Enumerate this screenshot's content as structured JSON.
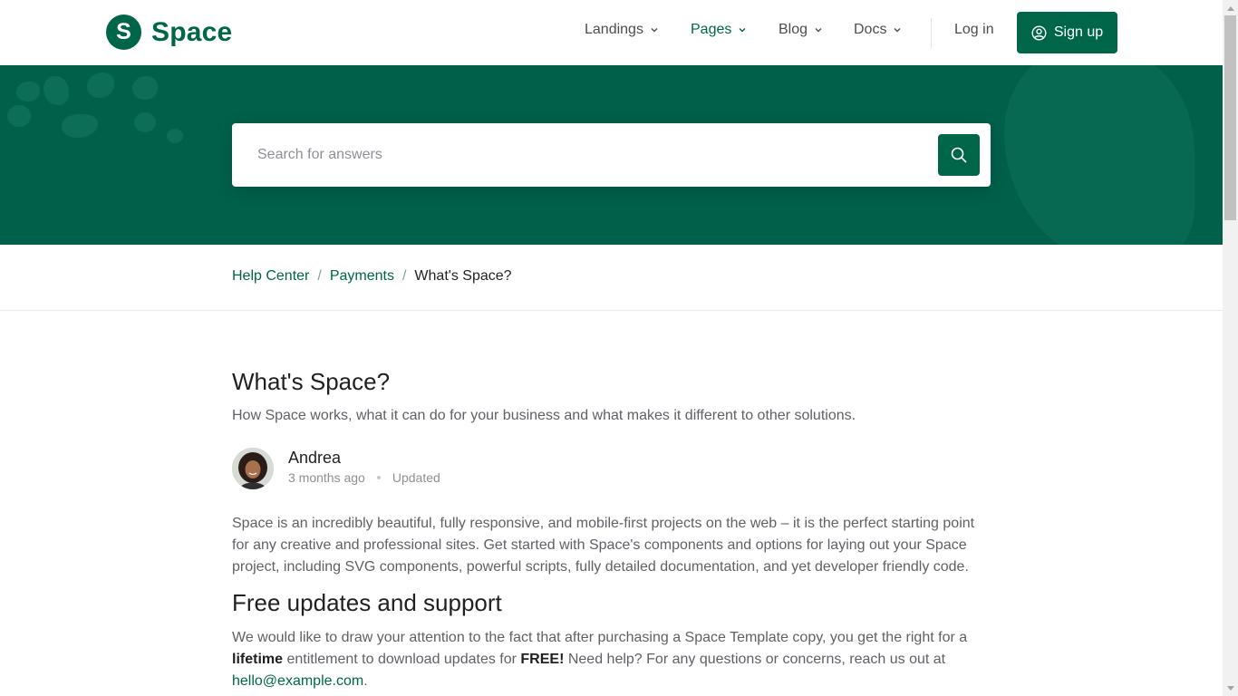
{
  "brand": {
    "logo_letter": "S",
    "name": "Space",
    "color": "#00664a"
  },
  "nav": {
    "items": [
      {
        "label": "Landings"
      },
      {
        "label": "Pages"
      },
      {
        "label": "Blog"
      },
      {
        "label": "Docs"
      }
    ],
    "active_item": "Pages",
    "login_label": "Log in",
    "signup_label": "Sign up"
  },
  "hero": {
    "background_color": "#00604a",
    "search": {
      "placeholder": "Search for answers",
      "value": ""
    }
  },
  "breadcrumb": {
    "items": [
      "Help Center",
      "Payments"
    ],
    "current": "What's Space?",
    "separator": "/"
  },
  "article": {
    "title": "What's Space?",
    "lead": "How Space works, what it can do for your business and what makes it different to other solutions.",
    "author": {
      "name": "Andrea",
      "time": "3 months ago",
      "status": "Updated"
    },
    "intro": "Space is an incredibly beautiful, fully responsive, and mobile-first projects on the web – it is the perfect starting point for any creative and professional sites. Get started with Space's components and options for laying out your Space project, including SVG components, powerful scripts, fully detailed documentation, and yet developer friendly code.",
    "section_title": "Free updates and support",
    "section_text_1": "We would like to draw your attention to the fact that after purchasing a Space Template copy, you get the right for a ",
    "section_bold_1": "lifetime",
    "section_text_2": " entitlement to download updates for ",
    "section_bold_2": "FREE!",
    "section_text_3": " Need help? For any questions or concerns, reach us out at ",
    "email": "hello@example.com",
    "section_text_4": "."
  }
}
